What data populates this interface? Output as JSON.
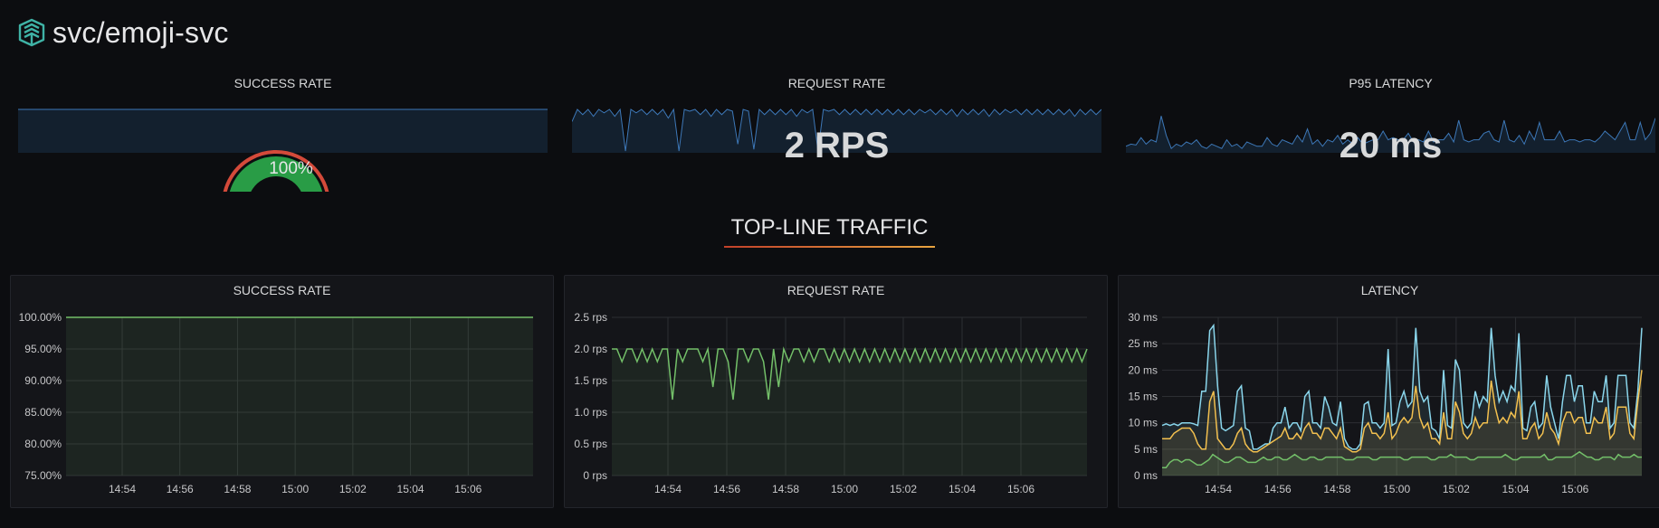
{
  "header": {
    "title": "svc/emoji-svc",
    "logo": "linkerd-logo-icon"
  },
  "colors": {
    "green": "#73bf69",
    "gauge_green": "#299c46",
    "gauge_red": "#d44a3a",
    "gauge_orange": "#ec8b2f",
    "blue": "#5794f2",
    "cyan": "#8ad6ec",
    "yellow": "#f2c04f",
    "spark_fill": "#13202e",
    "spark_line": "#3d78b8"
  },
  "stats": {
    "success_rate": {
      "title": "SUCCESS RATE",
      "value": "100%",
      "gauge_fraction": 1.0
    },
    "request_rate": {
      "title": "REQUEST RATE",
      "value": "2 RPS"
    },
    "p95_latency": {
      "title": "P95 LATENCY",
      "value": "20 ms"
    }
  },
  "section": {
    "title": "TOP-LINE TRAFFIC"
  },
  "panels": {
    "success_rate": {
      "title": "SUCCESS RATE"
    },
    "request_rate": {
      "title": "REQUEST RATE"
    },
    "latency": {
      "title": "LATENCY"
    }
  },
  "chart_data": [
    {
      "type": "line",
      "title": "SUCCESS RATE",
      "ylim": [
        75,
        100
      ],
      "y_ticks": [
        "100.00%",
        "95.00%",
        "90.00%",
        "85.00%",
        "80.00%",
        "75.00%"
      ],
      "x_ticks": [
        "14:54",
        "14:56",
        "14:58",
        "15:00",
        "15:02",
        "15:04",
        "15:06"
      ],
      "grid": true,
      "series": [
        {
          "color": "#73bf69",
          "values": [
            100,
            100,
            100,
            100,
            100,
            100,
            100,
            100,
            100,
            100,
            100,
            100,
            100,
            100,
            100,
            100,
            100,
            100,
            100,
            100,
            100,
            100,
            100,
            100,
            100,
            100,
            100,
            100,
            100,
            100,
            100,
            100,
            100,
            100,
            100,
            100,
            100,
            100,
            100,
            100
          ]
        }
      ]
    },
    {
      "type": "line",
      "title": "REQUEST RATE",
      "ylim": [
        0,
        2.5
      ],
      "y_ticks": [
        "2.5 rps",
        "2.0 rps",
        "1.5 rps",
        "1.0 rps",
        "0.5 rps",
        "0 rps"
      ],
      "x_ticks": [
        "14:54",
        "14:56",
        "14:58",
        "15:00",
        "15:02",
        "15:04",
        "15:06"
      ],
      "grid": true,
      "series": [
        {
          "color": "#73bf69",
          "values": [
            2,
            2,
            1.8,
            2,
            2,
            1.8,
            2,
            1.8,
            2,
            1.8,
            2,
            2,
            1.2,
            2,
            1.8,
            2,
            2,
            2,
            1.8,
            2,
            1.4,
            2,
            2,
            1.8,
            1.2,
            2,
            2,
            1.8,
            2,
            2,
            1.8,
            1.2,
            2,
            1.4,
            2,
            1.8,
            2,
            2,
            1.8,
            2,
            1.8,
            2,
            2,
            1.8,
            2,
            1.8,
            2,
            1.8,
            2,
            1.8,
            2,
            1.8,
            2,
            1.8,
            2,
            1.8,
            2,
            1.8,
            2,
            1.8,
            2,
            1.8,
            2,
            1.8,
            2,
            1.8,
            2,
            1.8,
            2,
            1.8,
            2,
            1.8,
            2,
            1.8,
            2,
            1.8,
            2,
            1.8,
            2,
            1.8,
            2,
            1.8,
            2,
            1.8,
            2,
            1.8,
            2,
            1.8,
            2,
            1.8,
            2,
            1.8,
            2,
            1.8,
            2
          ]
        }
      ]
    },
    {
      "type": "line",
      "title": "LATENCY",
      "ylim": [
        0,
        30
      ],
      "y_ticks": [
        "30 ms",
        "25 ms",
        "20 ms",
        "15 ms",
        "10 ms",
        "5 ms",
        "0 ms"
      ],
      "x_ticks": [
        "14:54",
        "14:56",
        "14:58",
        "15:00",
        "15:02",
        "15:04",
        "15:06"
      ],
      "grid": true,
      "series": [
        {
          "color": "#8ad6ec",
          "values": [
            9.5,
            9.8,
            9.5,
            9.8,
            9.5,
            10,
            10,
            10,
            9.8,
            9.5,
            16,
            16,
            27.5,
            28.5,
            17,
            9,
            8.5,
            9,
            9.5,
            16,
            17,
            9,
            8.5,
            5,
            5,
            5.5,
            6,
            6,
            9,
            10,
            10,
            13,
            9,
            10,
            10,
            8.5,
            15,
            16,
            10,
            10,
            9,
            15,
            13,
            10,
            9.5,
            14,
            7,
            5.5,
            5,
            5,
            6,
            13.5,
            14,
            10,
            10,
            9,
            10,
            24,
            9.5,
            10,
            14,
            16,
            13,
            14,
            28,
            16,
            14,
            15,
            9,
            8.5,
            7,
            20,
            9.5,
            9,
            22,
            20,
            10,
            9,
            10,
            16,
            13,
            15,
            14,
            28,
            19,
            14,
            16,
            14,
            17,
            16,
            27,
            9,
            8.5,
            13,
            14,
            9,
            10,
            19,
            13,
            10,
            7,
            14,
            19,
            19,
            14,
            17,
            17,
            10,
            10,
            16,
            14,
            14,
            19,
            9,
            10,
            19,
            19,
            19,
            10,
            9,
            16,
            28
          ]
        },
        {
          "color": "#f2c04f",
          "values": [
            7,
            7,
            7,
            8,
            8.5,
            9,
            9,
            9,
            8,
            6,
            5,
            5,
            14,
            16,
            7,
            6,
            5,
            5,
            6,
            8,
            9,
            6,
            5,
            4.5,
            4.5,
            5,
            5.5,
            6,
            6.5,
            7,
            7.5,
            9,
            7,
            7,
            8,
            7,
            9,
            10,
            8,
            8,
            7,
            9,
            9,
            8,
            7,
            9,
            5.5,
            5,
            4.5,
            4.5,
            5,
            9,
            10,
            8,
            8,
            7,
            8,
            12,
            7,
            8,
            10,
            11,
            10,
            11,
            17,
            11,
            9,
            10,
            7,
            7,
            6,
            12,
            7,
            7,
            14,
            12,
            8,
            7,
            8,
            11,
            9,
            10,
            10,
            18,
            13,
            10,
            11,
            10,
            12,
            11,
            16,
            7,
            7,
            9,
            10,
            7,
            8,
            12,
            9,
            8,
            6,
            10,
            12,
            12,
            10,
            11,
            11,
            8,
            8,
            11,
            10,
            10,
            13,
            7,
            8,
            13,
            13,
            13,
            8,
            7,
            14,
            20
          ]
        },
        {
          "color": "#73bf69",
          "values": [
            1.5,
            1.5,
            2.5,
            3,
            3,
            2.5,
            3,
            3,
            2.5,
            2,
            2,
            2.5,
            3,
            4,
            3.5,
            3,
            2.5,
            2.5,
            3,
            3.5,
            3.5,
            3,
            2.5,
            2.5,
            2.5,
            3,
            3.5,
            3,
            3,
            3.5,
            3.5,
            3,
            3,
            3.5,
            4,
            3.5,
            3,
            3,
            3.5,
            3.5,
            3,
            3,
            3.5,
            3.5,
            3.5,
            3.5,
            3.5,
            3,
            3,
            3,
            3.5,
            3.5,
            3.5,
            3.5,
            3,
            3,
            3.5,
            3.5,
            3.5,
            3.5,
            3.5,
            3.5,
            3,
            3,
            3.5,
            3.5,
            3.5,
            3.5,
            3.5,
            3,
            3,
            3.5,
            3.5,
            3.5,
            4,
            3.5,
            3.5,
            3.5,
            3.5,
            3,
            3,
            3.5,
            3.5,
            3.5,
            3.5,
            3.5,
            3.5,
            3.5,
            4,
            3.5,
            3,
            3,
            3.5,
            3.5,
            3.5,
            3.5,
            3.5,
            3.5,
            4,
            3,
            3,
            3.5,
            3.5,
            3.5,
            3.5,
            3.5,
            4,
            4.5,
            4,
            3.5,
            3.5,
            3,
            3,
            3.5,
            3.5,
            3.5,
            3,
            4,
            3.5,
            3.5,
            3.5,
            4,
            3.5,
            3.5
          ]
        }
      ]
    }
  ],
  "sparklines": {
    "request_rate": [
      1.8,
      2.5,
      2.2,
      2.5,
      2.1,
      2.5,
      2.3,
      2.5,
      2.1,
      2.5,
      0.1,
      2.5,
      2.3,
      2.5,
      2.2,
      2.5,
      2.2,
      2.5,
      2,
      2.5,
      0.1,
      2.5,
      2.4,
      2.5,
      2.2,
      2.5,
      2.1,
      2.5,
      2.2,
      2.5,
      2.4,
      0.5,
      2.5,
      2.4,
      0.2,
      2.5,
      2.2,
      2.5,
      2.2,
      2.5,
      2.2,
      2.5,
      2.1,
      2.5,
      2.3,
      2.5,
      0.1,
      2.5,
      2.4,
      2.5,
      2.2,
      2.5,
      2.2,
      2.5,
      2.2,
      2.5,
      2.2,
      2.5,
      2.2,
      2.5,
      2.2,
      2.5,
      2.2,
      2.5,
      2.2,
      2.5,
      2.3,
      2.5,
      2.2,
      2.5,
      2.2,
      2.5,
      2.1,
      2.5,
      2.2,
      2.5,
      2.2,
      2.5,
      2.1,
      2.5,
      2.2,
      2.5,
      2.3,
      2.5,
      2.2,
      2.5,
      2.2,
      2.5,
      2.2,
      2.5,
      2.2,
      2.5,
      2.2,
      2.5,
      2.1,
      2.5,
      2.2,
      2.5,
      2.2,
      2.5
    ],
    "p95_latency": [
      0.15,
      0.2,
      0.18,
      0.35,
      0.2,
      0.3,
      0.25,
      0.85,
      0.4,
      0.1,
      0.2,
      0.15,
      0.25,
      0.2,
      0.3,
      0.15,
      0.1,
      0.2,
      0.15,
      0.1,
      0.3,
      0.15,
      0.2,
      0.1,
      0.25,
      0.2,
      0.15,
      0.15,
      0.35,
      0.2,
      0.15,
      0.3,
      0.25,
      0.2,
      0.4,
      0.25,
      0.55,
      0.2,
      0.3,
      0.15,
      0.3,
      0.25,
      0.4,
      0.2,
      0.3,
      0.2,
      0.35,
      0.2,
      0.25,
      0.3,
      0.3,
      0.5,
      0.3,
      0.35,
      0.3,
      0.3,
      0.45,
      0.25,
      0.3,
      0.25,
      0.5,
      0.25,
      0.3,
      0.3,
      0.45,
      0.25,
      0.75,
      0.3,
      0.25,
      0.3,
      0.3,
      0.45,
      0.5,
      0.3,
      0.25,
      0.75,
      0.3,
      0.25,
      0.4,
      0.2,
      0.5,
      0.3,
      0.7,
      0.3,
      0.3,
      0.3,
      0.5,
      0.25,
      0.3,
      0.3,
      0.25,
      0.3,
      0.3,
      0.25,
      0.35,
      0.5,
      0.4,
      0.3,
      0.5,
      0.7,
      0.3,
      0.3,
      0.7,
      0.3,
      0.45,
      0.8
    ]
  }
}
